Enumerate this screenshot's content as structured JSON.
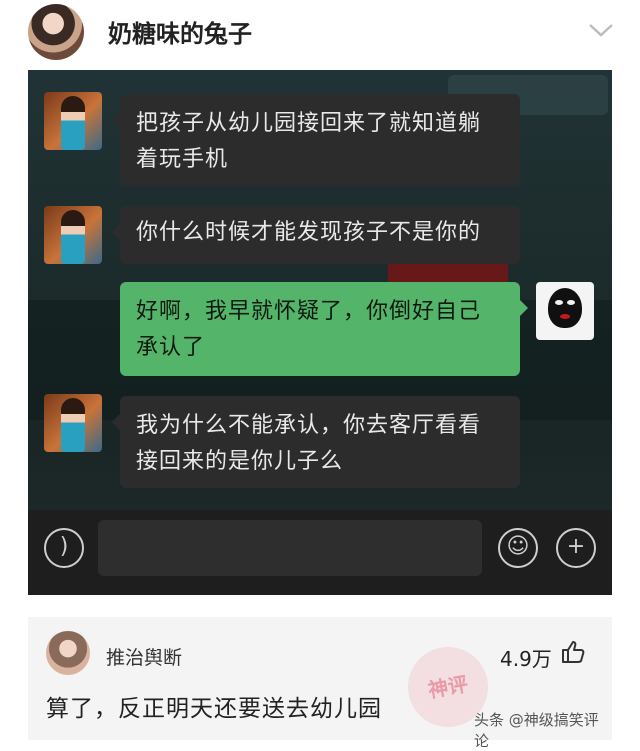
{
  "header": {
    "username": "奶糖味的兔子",
    "chevron_icon": "chevron-down-icon"
  },
  "chat": {
    "messages": [
      {
        "side": "left",
        "lines": [
          "把孩子从幼儿园接回来了就知道躺",
          "着玩手机"
        ]
      },
      {
        "side": "left",
        "lines": [
          "你什么时候才能发现孩子不是你的"
        ]
      },
      {
        "side": "right",
        "lines": [
          "好啊，我早就怀疑了，你倒好自己",
          "承认了"
        ]
      },
      {
        "side": "left",
        "lines": [
          "我为什么不能承认，你去客厅看看",
          "接回来的是你儿子么"
        ]
      }
    ],
    "input_bar": {
      "voice_icon": "voice-icon",
      "emoji_icon": "emoji-icon",
      "plus_icon": "plus-icon"
    }
  },
  "comment": {
    "author": "推治舆断",
    "likes": "4.9万",
    "text": "算了，反正明天还要送去幼儿园",
    "stamp": "神评",
    "watermark": "头条 @神级搞笑评论"
  }
}
